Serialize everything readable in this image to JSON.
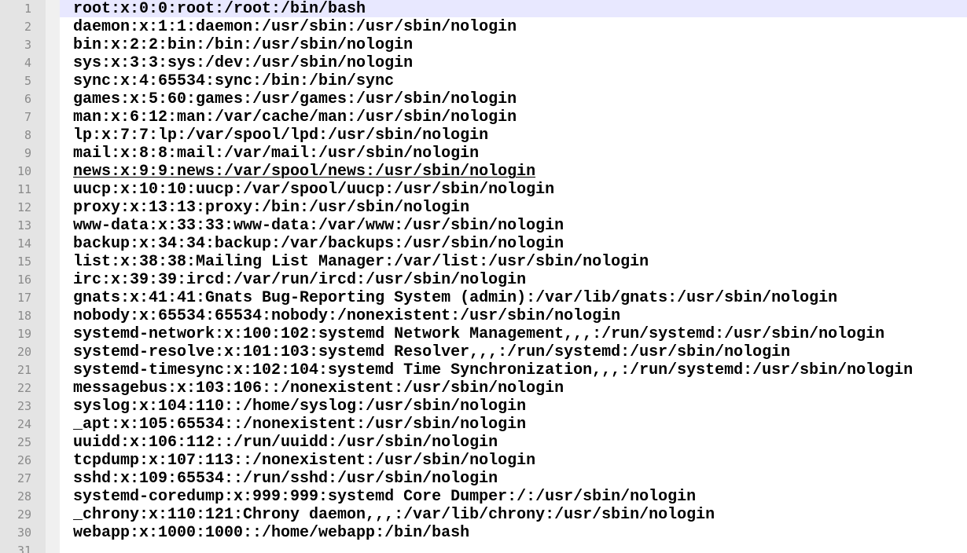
{
  "editor": {
    "lines": [
      {
        "no": "1",
        "text": "root:x:0:0:root:/root:/bin/bash"
      },
      {
        "no": "2",
        "text": "daemon:x:1:1:daemon:/usr/sbin:/usr/sbin/nologin"
      },
      {
        "no": "3",
        "text": "bin:x:2:2:bin:/bin:/usr/sbin/nologin"
      },
      {
        "no": "4",
        "text": "sys:x:3:3:sys:/dev:/usr/sbin/nologin"
      },
      {
        "no": "5",
        "text": "sync:x:4:65534:sync:/bin:/bin/sync"
      },
      {
        "no": "6",
        "text": "games:x:5:60:games:/usr/games:/usr/sbin/nologin"
      },
      {
        "no": "7",
        "text": "man:x:6:12:man:/var/cache/man:/usr/sbin/nologin"
      },
      {
        "no": "8",
        "text": "lp:x:7:7:lp:/var/spool/lpd:/usr/sbin/nologin"
      },
      {
        "no": "9",
        "text": "mail:x:8:8:mail:/var/mail:/usr/sbin/nologin"
      },
      {
        "no": "10",
        "text": "news:x:9:9:news:/var/spool/news:/usr/sbin/nologin"
      },
      {
        "no": "11",
        "text": "uucp:x:10:10:uucp:/var/spool/uucp:/usr/sbin/nologin"
      },
      {
        "no": "12",
        "text": "proxy:x:13:13:proxy:/bin:/usr/sbin/nologin"
      },
      {
        "no": "13",
        "text": "www-data:x:33:33:www-data:/var/www:/usr/sbin/nologin"
      },
      {
        "no": "14",
        "text": "backup:x:34:34:backup:/var/backups:/usr/sbin/nologin"
      },
      {
        "no": "15",
        "text": "list:x:38:38:Mailing List Manager:/var/list:/usr/sbin/nologin"
      },
      {
        "no": "16",
        "text": "irc:x:39:39:ircd:/var/run/ircd:/usr/sbin/nologin"
      },
      {
        "no": "17",
        "text": "gnats:x:41:41:Gnats Bug-Reporting System (admin):/var/lib/gnats:/usr/sbin/nologin"
      },
      {
        "no": "18",
        "text": "nobody:x:65534:65534:nobody:/nonexistent:/usr/sbin/nologin"
      },
      {
        "no": "19",
        "text": "systemd-network:x:100:102:systemd Network Management,,,:/run/systemd:/usr/sbin/nologin"
      },
      {
        "no": "20",
        "text": "systemd-resolve:x:101:103:systemd Resolver,,,:/run/systemd:/usr/sbin/nologin"
      },
      {
        "no": "21",
        "text": "systemd-timesync:x:102:104:systemd Time Synchronization,,,:/run/systemd:/usr/sbin/nologin"
      },
      {
        "no": "22",
        "text": "messagebus:x:103:106::/nonexistent:/usr/sbin/nologin"
      },
      {
        "no": "23",
        "text": "syslog:x:104:110::/home/syslog:/usr/sbin/nologin"
      },
      {
        "no": "24",
        "text": "_apt:x:105:65534::/nonexistent:/usr/sbin/nologin"
      },
      {
        "no": "25",
        "text": "uuidd:x:106:112::/run/uuidd:/usr/sbin/nologin"
      },
      {
        "no": "26",
        "text": "tcpdump:x:107:113::/nonexistent:/usr/sbin/nologin"
      },
      {
        "no": "27",
        "text": "sshd:x:109:65534::/run/sshd:/usr/sbin/nologin"
      },
      {
        "no": "28",
        "text": "systemd-coredump:x:999:999:systemd Core Dumper:/:/usr/sbin/nologin"
      },
      {
        "no": "29",
        "text": "_chrony:x:110:121:Chrony daemon,,,:/var/lib/chrony:/usr/sbin/nologin"
      },
      {
        "no": "30",
        "text": "webapp:x:1000:1000::/home/webapp:/bin/bash"
      },
      {
        "no": "31",
        "text": ""
      }
    ],
    "colors": {
      "gutter": "#e4e4e4",
      "active_line": "#e8e8ff",
      "line_number": "#8a8a8a",
      "text": "#000000"
    }
  }
}
